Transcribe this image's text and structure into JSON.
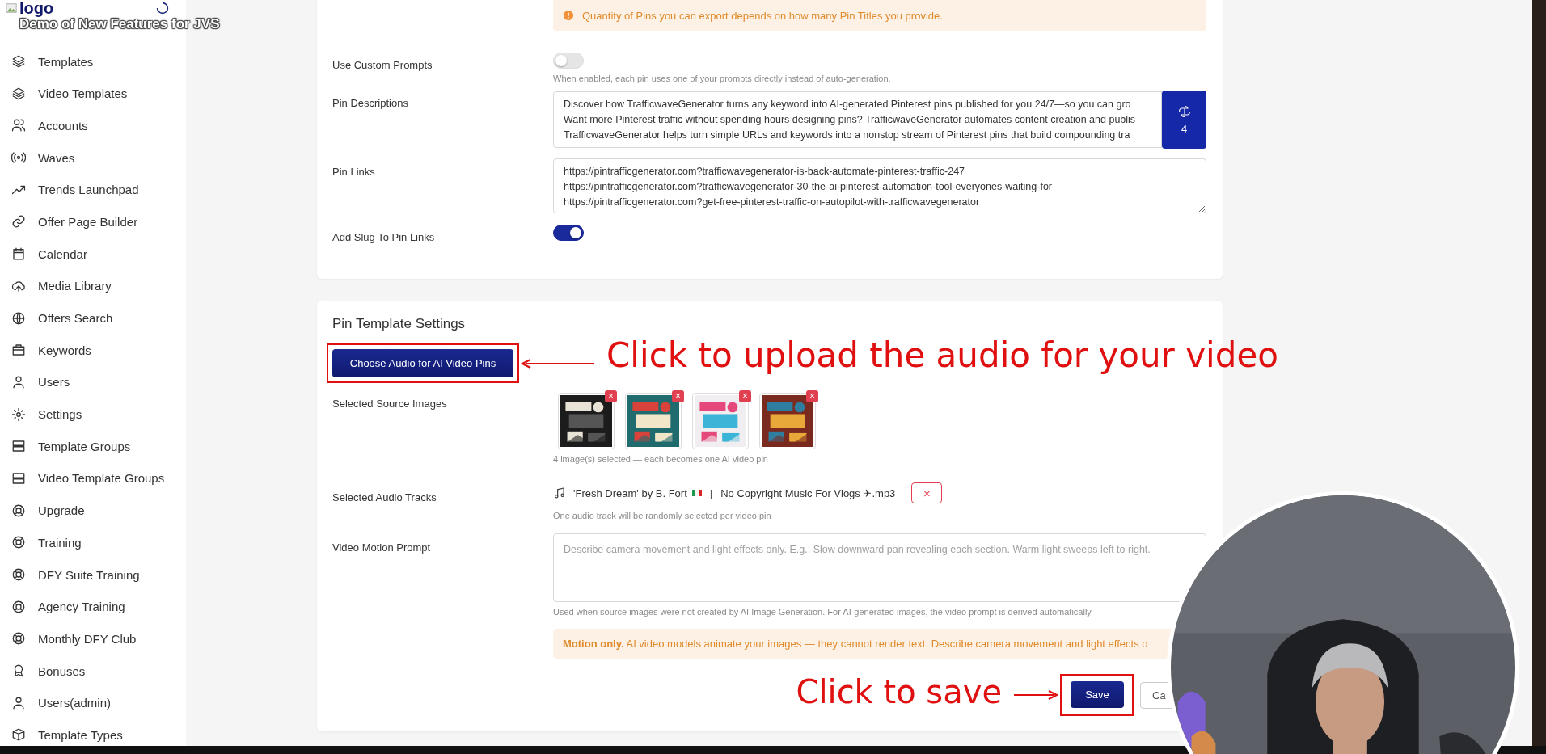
{
  "header": {
    "logo_alt": "logo",
    "video_title": "Demo of New Features for JVS"
  },
  "sidebar": {
    "items": [
      {
        "label": "Templates"
      },
      {
        "label": "Video Templates"
      },
      {
        "label": "Accounts"
      },
      {
        "label": "Waves"
      },
      {
        "label": "Trends Launchpad"
      },
      {
        "label": "Offer Page Builder"
      },
      {
        "label": "Calendar"
      },
      {
        "label": "Media Library"
      },
      {
        "label": "Offers Search"
      },
      {
        "label": "Keywords"
      },
      {
        "label": "Users"
      },
      {
        "label": "Settings"
      },
      {
        "label": "Template Groups"
      },
      {
        "label": "Video Template Groups"
      },
      {
        "label": "Upgrade"
      },
      {
        "label": "Training"
      },
      {
        "label": "DFY Suite Training"
      },
      {
        "label": "Agency Training"
      },
      {
        "label": "Monthly DFY Club"
      },
      {
        "label": "Bonuses"
      },
      {
        "label": "Users(admin)"
      },
      {
        "label": "Template Types"
      }
    ]
  },
  "pin_settings": {
    "notice": "Quantity of Pins you can export depends on how many Pin Titles you provide.",
    "use_custom_prompts": {
      "label": "Use Custom Prompts",
      "on": false,
      "hint": "When enabled, each pin uses one of your prompts directly instead of auto-generation."
    },
    "pin_descriptions": {
      "label": "Pin Descriptions",
      "ai_count": "4",
      "lines": [
        "Discover how TrafficwaveGenerator turns any keyword into AI-generated Pinterest pins published for you 24/7—so you can gro",
        "Want more Pinterest traffic without spending hours designing pins? TrafficwaveGenerator automates content creation and publis",
        "TrafficwaveGenerator helps turn simple URLs and keywords into a nonstop stream of Pinterest pins that build compounding tra"
      ]
    },
    "pin_links": {
      "label": "Pin Links",
      "lines": [
        "https://pintrafficgenerator.com?trafficwavegenerator-is-back-automate-pinterest-traffic-247",
        "https://pintrafficgenerator.com?trafficwavegenerator-30-the-ai-pinterest-automation-tool-everyones-waiting-for",
        "https://pintrafficgenerator.com?get-free-pinterest-traffic-on-autopilot-with-trafficwavegenerator"
      ]
    },
    "add_slug": {
      "label": "Add Slug To Pin Links",
      "on": true
    }
  },
  "template_settings": {
    "title": "Pin Template Settings",
    "audio_button": "Choose Audio for AI Video Pins",
    "source_images": {
      "label": "Selected Source Images",
      "images": [
        {
          "kind": "picture",
          "remove": "×"
        },
        {
          "kind": "picture",
          "remove": "×"
        },
        {
          "kind": "picture",
          "remove": "×"
        },
        {
          "kind": "picture",
          "remove": "×"
        }
      ],
      "caption": "4 image(s) selected — each becomes one AI video pin"
    },
    "audio_tracks": {
      "label": "Selected Audio Tracks",
      "tracks": [
        {
          "name": "'Fresh Dream' by B. Fort",
          "separator": "|",
          "file": "No Copyright Music For Vlogs ✈.mp3",
          "remove": "×"
        }
      ],
      "hint": "One audio track will be randomly selected per video pin"
    },
    "motion_prompt": {
      "label": "Video Motion Prompt",
      "placeholder": "Describe camera movement and light effects only. E.g.: Slow downward pan revealing each section. Warm light sweeps left to right.",
      "hint": "Used when source images were not created by AI Image Generation. For AI-generated images, the video prompt is derived automatically."
    },
    "motion_notice": "**Motion only.** AI video models animate your images — they cannot render text. Describe camera movement and light effects o",
    "buttons": [
      {
        "label": "Save",
        "kind": "primary"
      },
      {
        "label": "Ca",
        "kind": "secondary"
      }
    ]
  },
  "annotations": [
    {
      "kind": "upload",
      "text": "Click to upload the audio for your video"
    },
    {
      "kind": "save",
      "text": "Click to save"
    }
  ]
}
